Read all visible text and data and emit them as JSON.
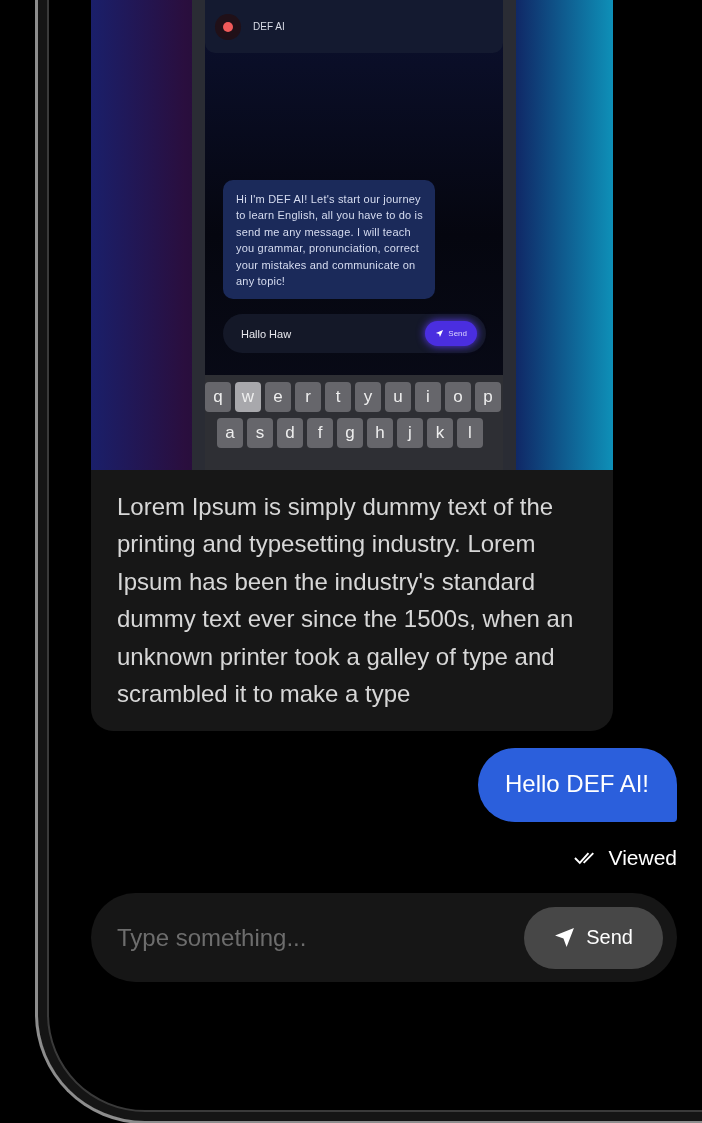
{
  "attachment": {
    "app_header": {
      "title": "DEF AI"
    },
    "bot_message": "Hi I'm DEF AI! Let's start our journey to learn English, all you have to do is send me any message. I will teach you grammar, pronunciation, correct your mistakes and communicate on any topic!",
    "input": {
      "value": "Hallo Haw"
    },
    "send_button": "Send",
    "keyboard_rows": [
      [
        {
          "label": "q",
          "pressed": false
        },
        {
          "label": "w",
          "pressed": true
        },
        {
          "label": "e",
          "pressed": false
        },
        {
          "label": "r",
          "pressed": false
        },
        {
          "label": "t",
          "pressed": false
        },
        {
          "label": "y",
          "pressed": false
        },
        {
          "label": "u",
          "pressed": false
        },
        {
          "label": "i",
          "pressed": false
        },
        {
          "label": "o",
          "pressed": false
        },
        {
          "label": "p",
          "pressed": false
        }
      ],
      [
        {
          "label": "a",
          "pressed": false
        },
        {
          "label": "s",
          "pressed": false
        },
        {
          "label": "d",
          "pressed": false
        },
        {
          "label": "f",
          "pressed": false
        },
        {
          "label": "g",
          "pressed": false
        },
        {
          "label": "h",
          "pressed": false
        },
        {
          "label": "j",
          "pressed": false
        },
        {
          "label": "k",
          "pressed": false
        },
        {
          "label": "l",
          "pressed": false
        }
      ]
    ]
  },
  "messages": [
    {
      "kind": "incoming",
      "text": "Lorem Ipsum is simply dummy text of the printing and typesetting industry. Lorem Ipsum has been the industry's standard dummy text ever since the 1500s, when an unknown printer took a galley of type and scrambled it to make a type"
    },
    {
      "kind": "outgoing",
      "text": "Hello DEF AI!",
      "status": "Viewed"
    }
  ],
  "composer": {
    "placeholder": "Type something...",
    "send_button": "Send"
  }
}
